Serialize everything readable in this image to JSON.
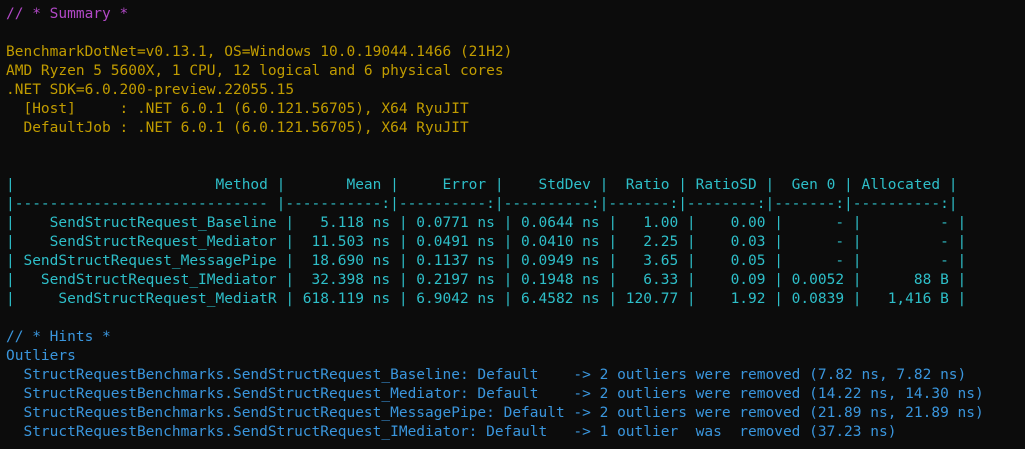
{
  "summary_header": "// * Summary *",
  "env": [
    "BenchmarkDotNet=v0.13.1, OS=Windows 10.0.19044.1466 (21H2)",
    "AMD Ryzen 5 5600X, 1 CPU, 12 logical and 6 physical cores",
    ".NET SDK=6.0.200-preview.22055.15",
    "  [Host]     : .NET 6.0.1 (6.0.121.56705), X64 RyuJIT",
    "  DefaultJob : .NET 6.0.1 (6.0.121.56705), X64 RyuJIT"
  ],
  "table": {
    "header": "|                       Method |       Mean |     Error |    StdDev |  Ratio | RatioSD |  Gen 0 | Allocated |",
    "separator": "|----------------------------- |-----------:|----------:|----------:|-------:|--------:|-------:|----------:|",
    "rows": [
      "|    SendStructRequest_Baseline |   5.118 ns | 0.0771 ns | 0.0644 ns |   1.00 |    0.00 |      - |         - |",
      "|    SendStructRequest_Mediator |  11.503 ns | 0.0491 ns | 0.0410 ns |   2.25 |    0.03 |      - |         - |",
      "| SendStructRequest_MessagePipe |  18.690 ns | 0.1137 ns | 0.0949 ns |   3.65 |    0.05 |      - |         - |",
      "|   SendStructRequest_IMediator |  32.398 ns | 0.2197 ns | 0.1948 ns |   6.33 |    0.09 | 0.0052 |      88 B |",
      "|     SendStructRequest_MediatR | 618.119 ns | 6.9042 ns | 6.4582 ns | 120.77 |    1.92 | 0.0839 |   1,416 B |"
    ]
  },
  "hints_header": "// * Hints *",
  "outliers_label": "Outliers",
  "outliers": [
    "  StructRequestBenchmarks.SendStructRequest_Baseline: Default    -> 2 outliers were removed (7.82 ns, 7.82 ns)",
    "  StructRequestBenchmarks.SendStructRequest_Mediator: Default    -> 2 outliers were removed (14.22 ns, 14.30 ns)",
    "  StructRequestBenchmarks.SendStructRequest_MessagePipe: Default -> 2 outliers were removed (21.89 ns, 21.89 ns)",
    "  StructRequestBenchmarks.SendStructRequest_IMediator: Default   -> 1 outlier  was  removed (37.23 ns)"
  ],
  "colors": {
    "background": "#0c0c0c",
    "header": "#b148c6",
    "env": "#c19c00",
    "table": "#2ebfc9",
    "hints": "#3a96dd"
  }
}
